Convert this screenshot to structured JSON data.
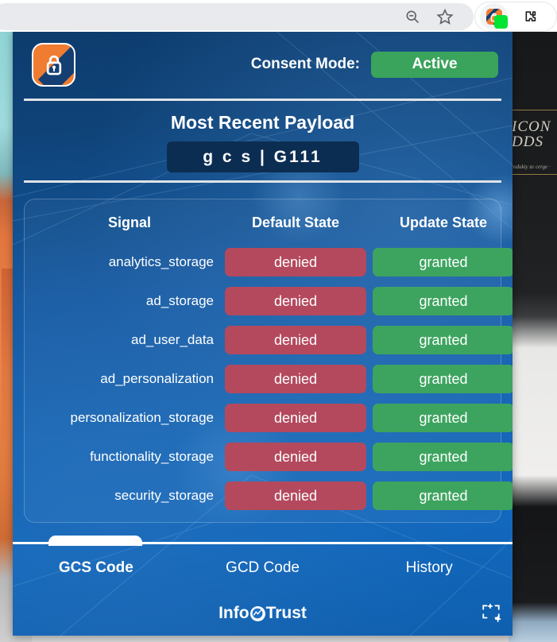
{
  "browser_toolbar": {
    "icons": [
      {
        "name": "zoom-out-icon",
        "glyph": "magnifier-minus"
      },
      {
        "name": "bookmark-star-icon",
        "glyph": "star-outline"
      },
      {
        "name": "extension-action-icon",
        "glyph": "consent-lock-logo",
        "badge_color": "#00e532"
      },
      {
        "name": "extensions-puzzle-icon",
        "glyph": "puzzle-piece"
      }
    ]
  },
  "page_background": {
    "right_heading": "ICON DDS",
    "right_subtext": "produkty\nze cerge\n·"
  },
  "popup": {
    "logo": {
      "name": "app-logo",
      "alt": "consent lock logo"
    },
    "header": {
      "consent_mode_label": "Consent Mode:",
      "consent_mode_status": "Active",
      "status_color": "#3aa35c"
    },
    "payload": {
      "title": "Most Recent Payload",
      "value": "g c s  |  G111"
    },
    "signals_table": {
      "columns": [
        "Signal",
        "Default State",
        "Update State"
      ],
      "rows": [
        {
          "signal": "analytics_storage",
          "default_state": "denied",
          "update_state": "granted"
        },
        {
          "signal": "ad_storage",
          "default_state": "denied",
          "update_state": "granted"
        },
        {
          "signal": "ad_user_data",
          "default_state": "denied",
          "update_state": "granted"
        },
        {
          "signal": "ad_personalization",
          "default_state": "denied",
          "update_state": "granted"
        },
        {
          "signal": "personalization_storage",
          "default_state": "denied",
          "update_state": "granted"
        },
        {
          "signal": "functionality_storage",
          "default_state": "denied",
          "update_state": "granted"
        },
        {
          "signal": "security_storage",
          "default_state": "denied",
          "update_state": "granted"
        }
      ],
      "denied_color": "#b4495e",
      "granted_color": "#3da45f"
    },
    "tabs": [
      {
        "label": "GCS Code",
        "active": true
      },
      {
        "label": "GCD Code",
        "active": false
      },
      {
        "label": "History",
        "active": false
      }
    ],
    "footer": {
      "brand_prefix": "Info",
      "brand_suffix": "Trust",
      "capture_icon": "capture-region-icon"
    }
  }
}
